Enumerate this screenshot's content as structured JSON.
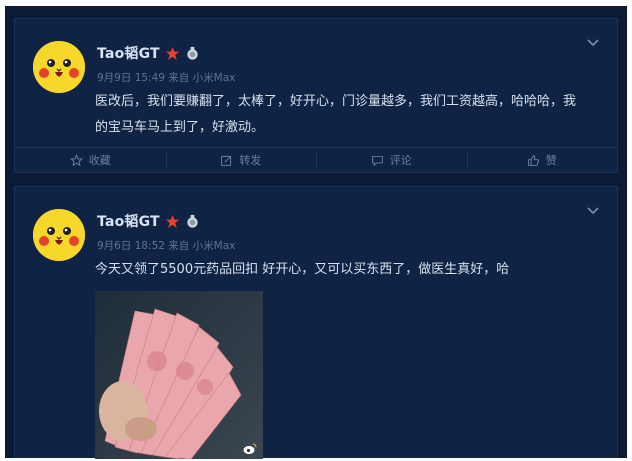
{
  "posts": [
    {
      "username": "Tao韬GT",
      "meta": "9月9日 15:49 来自 小米Max",
      "text": "医改后，我们要赚翻了，太棒了，好开心，门诊量越多，我们工资越高，哈哈哈，我的宝马车马上到了，好激动。",
      "actions": {
        "favorite": "收藏",
        "repost": "转发",
        "comment": "评论",
        "like": "赞"
      }
    },
    {
      "username": "Tao韬GT",
      "meta": "9月6日 18:52 来自 小米Max",
      "text": "今天又领了5500元药品回扣 好开心，又可以买东西了，做医生真好，哈"
    }
  ],
  "icons": {
    "vip": "red-star-icon",
    "medal": "medal-icon",
    "menu": "chevron-down-icon"
  },
  "colors": {
    "background": "#0d1a33",
    "card": "#0f2345",
    "text": "#d7e1ee",
    "meta": "#5f7393",
    "star": "#e8402b"
  }
}
